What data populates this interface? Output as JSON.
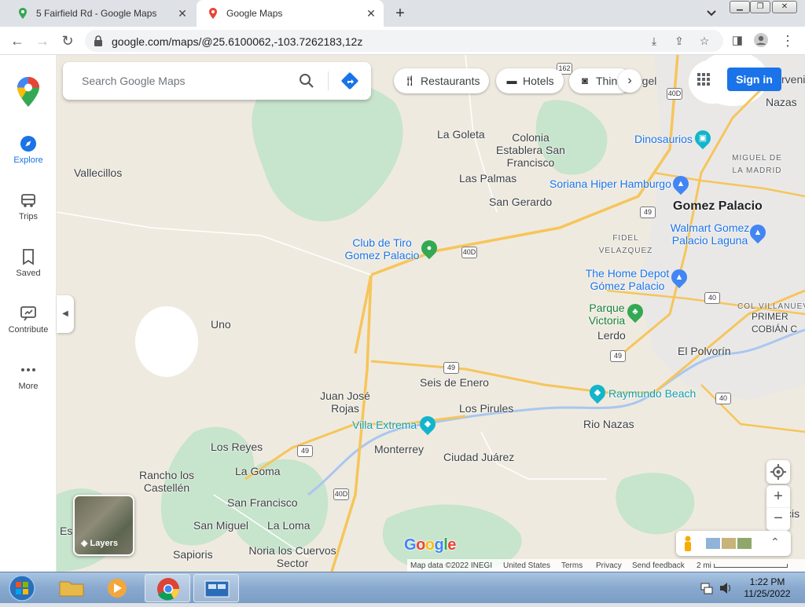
{
  "tabs": [
    {
      "title": "5 Fairfield Rd - Google Maps"
    },
    {
      "title": "Google Maps"
    }
  ],
  "address_bar": {
    "url": "google.com/maps/@25.6100062,-103.7262183,12z"
  },
  "sidebar": {
    "items": [
      {
        "label": "Explore",
        "icon": "explore-icon"
      },
      {
        "label": "Trips",
        "icon": "trips-icon"
      },
      {
        "label": "Saved",
        "icon": "bookmark-icon"
      },
      {
        "label": "Contribute",
        "icon": "contribute-icon"
      },
      {
        "label": "More",
        "icon": "more-icon"
      }
    ]
  },
  "search": {
    "placeholder": "Search Google Maps"
  },
  "chips": [
    {
      "label": "Restaurants",
      "icon": "fork-knife-icon"
    },
    {
      "label": "Hotels",
      "icon": "bed-icon"
    },
    {
      "label": "Thin",
      "icon": "camera-icon"
    }
  ],
  "signin_label": "Sign in",
  "layers_label": "Layers",
  "google_logo": [
    "G",
    "o",
    "o",
    "g",
    "l",
    "e"
  ],
  "logo_colors": [
    "#4285F4",
    "#EA4335",
    "#FBBC05",
    "#4285F4",
    "#34A853",
    "#EA4335"
  ],
  "attribution": {
    "map_data": "Map data ©2022 INEGI",
    "country": "United States",
    "terms": "Terms",
    "privacy": "Privacy",
    "feedback": "Send feedback",
    "scale": "2 mi"
  },
  "places": [
    {
      "name": "Vallecillos"
    },
    {
      "name": "La Goleta"
    },
    {
      "name": "Colonia Establera San Francisco"
    },
    {
      "name": "Las Palmas"
    },
    {
      "name": "San Gerardo"
    },
    {
      "name": "Club de Tiro Gomez Palacio"
    },
    {
      "name": "Uno"
    },
    {
      "name": "Dinosaurios"
    },
    {
      "name": "Soriana Hiper Hamburgo"
    },
    {
      "name": "Gomez Palacio"
    },
    {
      "name": "Walmart Gomez Palacio Laguna"
    },
    {
      "name": "FIDEL VELAZQUEZ"
    },
    {
      "name": "The Home Depot Gómez Palacio"
    },
    {
      "name": "Parque Victoria"
    },
    {
      "name": "Lerdo"
    },
    {
      "name": "El Polvorín"
    },
    {
      "name": "Seis de Enero"
    },
    {
      "name": "Juan José Rojas"
    },
    {
      "name": "Raymundo Beach"
    },
    {
      "name": "Los Pirules"
    },
    {
      "name": "Villa Extrema"
    },
    {
      "name": "Rio Nazas"
    },
    {
      "name": "Monterrey"
    },
    {
      "name": "Ciudad Juárez"
    },
    {
      "name": "Los Reyes"
    },
    {
      "name": "Rancho los Castellén"
    },
    {
      "name": "La Goma"
    },
    {
      "name": "San Francisco"
    },
    {
      "name": "San Miguel"
    },
    {
      "name": "La Loma"
    },
    {
      "name": "Sapioris"
    },
    {
      "name": "Noria los Cuervos Sector"
    },
    {
      "name": "Nazas"
    },
    {
      "name": "MIGUEL DE LA MADRID"
    },
    {
      "name": "COL VILLANUEVA"
    },
    {
      "name": "PRIMER COBIÁN C"
    },
    {
      "name": "rgel"
    },
    {
      "name": "rvenir"
    },
    {
      "name": "Es"
    },
    {
      "name": "cis"
    }
  ],
  "road_shields": [
    "162",
    "40D",
    "49",
    "40D",
    "40",
    "49",
    "49",
    "40",
    "49",
    "40D"
  ],
  "taskbar": {
    "time": "1:22 PM",
    "date": "11/25/2022"
  }
}
